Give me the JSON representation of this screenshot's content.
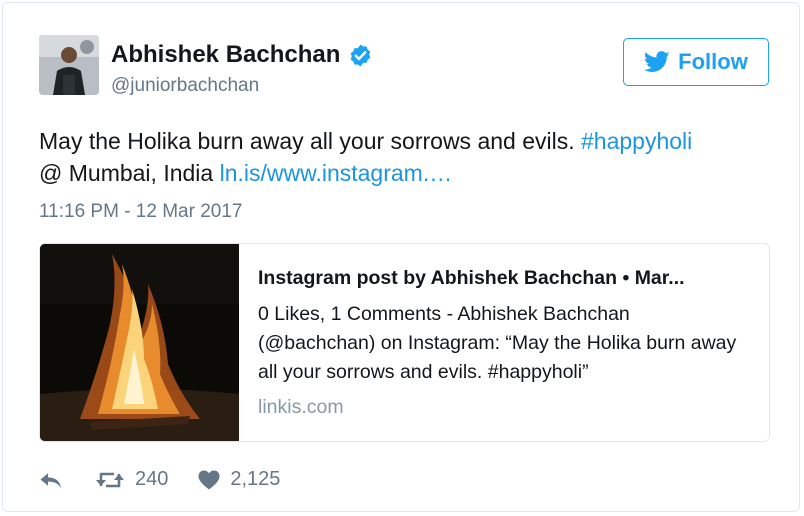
{
  "author": {
    "name": "Abhishek Bachchan",
    "handle": "@juniorbachchan",
    "verified_icon": "verified-badge-icon"
  },
  "follow_button": {
    "label": "Follow",
    "icon": "twitter-bird-icon"
  },
  "tweet": {
    "text_main": "May the Holika burn away all your sorrows and evils.",
    "hashtag": "#happyholi",
    "location": "@ Mumbai, India",
    "link_text": "ln.is/www.instagram.…",
    "timestamp": "11:16 PM - 12 Mar 2017"
  },
  "embed": {
    "title": "Instagram post by Abhishek Bachchan • Mar...",
    "description": "0 Likes, 1 Comments - Abhishek Bachchan (@bachchan) on Instagram: “May the Holika burn away all your sorrows and evils. #happyholi”",
    "domain": "linkis.com"
  },
  "actions": {
    "reply_icon": "reply-icon",
    "retweet_icon": "retweet-icon",
    "retweet_count": "240",
    "like_icon": "heart-icon",
    "like_count": "2,125"
  },
  "colors": {
    "accent": "#1da1f2",
    "link": "#1b95e0",
    "muted": "#657786",
    "border": "#e1e8ed"
  }
}
